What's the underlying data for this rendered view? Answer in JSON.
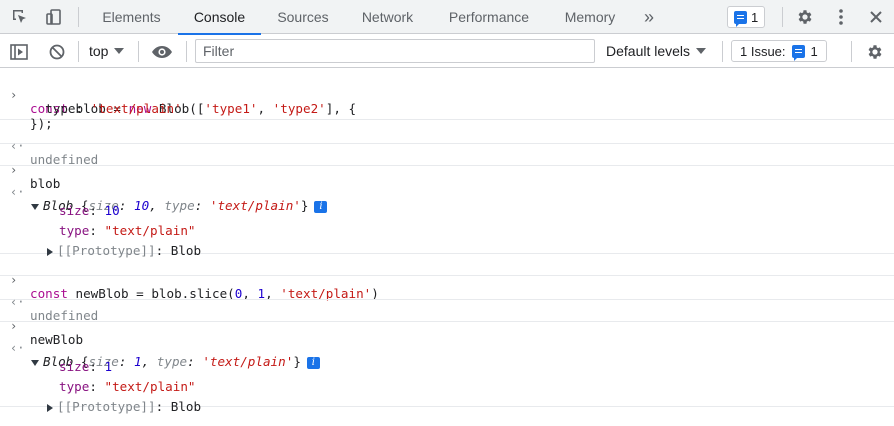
{
  "tabs": {
    "items": [
      "Elements",
      "Console",
      "Sources",
      "Network",
      "Performance",
      "Memory"
    ],
    "active": "Console",
    "more": "»"
  },
  "header_badge": {
    "count": "1"
  },
  "toolbar": {
    "context": "top",
    "filter_placeholder": "Filter",
    "levels": "Default levels",
    "issues": "1 Issue:",
    "issues_count": "1"
  },
  "console": {
    "l1": {
      "c1": "const",
      "c2": " blob = ",
      "c3": "new",
      "c4": " Blob([",
      "c5": "'type1'",
      "c6": ", ",
      "c7": "'type2'",
      "c8": "], {"
    },
    "l2": {
      "c1": "  type: ",
      "c2": "'text/plain'"
    },
    "l3": "});",
    "r1": "undefined",
    "l4": "blob",
    "o1": {
      "name": "Blob",
      "open": " {",
      "size_key": "size",
      "size_val": "10",
      "type_key": "type",
      "type_val": "'text/plain'",
      "close": "}",
      "size_line_key": "size",
      "size_line_val": "10",
      "type_line_key": "type",
      "type_line_val": "\"text/plain\"",
      "proto_key": "[[Prototype]]",
      "proto_val": "Blob"
    },
    "l5": {
      "c1": "const",
      "c2": " newBlob = blob.slice(",
      "c3": "0",
      "c4": ", ",
      "c5": "1",
      "c6": ", ",
      "c7": "'text/plain'",
      "c8": ")"
    },
    "r2": "undefined",
    "l6": "newBlob",
    "o2": {
      "name": "Blob",
      "open": " {",
      "size_key": "size",
      "size_val": "1",
      "type_key": "type",
      "type_val": "'text/plain'",
      "close": "}",
      "size_line_key": "size",
      "size_line_val": "1",
      "type_line_key": "type",
      "type_line_val": "\"text/plain\"",
      "proto_key": "[[Prototype]]",
      "proto_val": "Blob"
    },
    "prompt_glyph": "›",
    "result_glyph": "‹·",
    "info_glyph": "i"
  },
  "colors": {
    "accent": "#1a73e8",
    "keyword": "#aa0d91",
    "string": "#c41a16",
    "number": "#1c00cf"
  }
}
